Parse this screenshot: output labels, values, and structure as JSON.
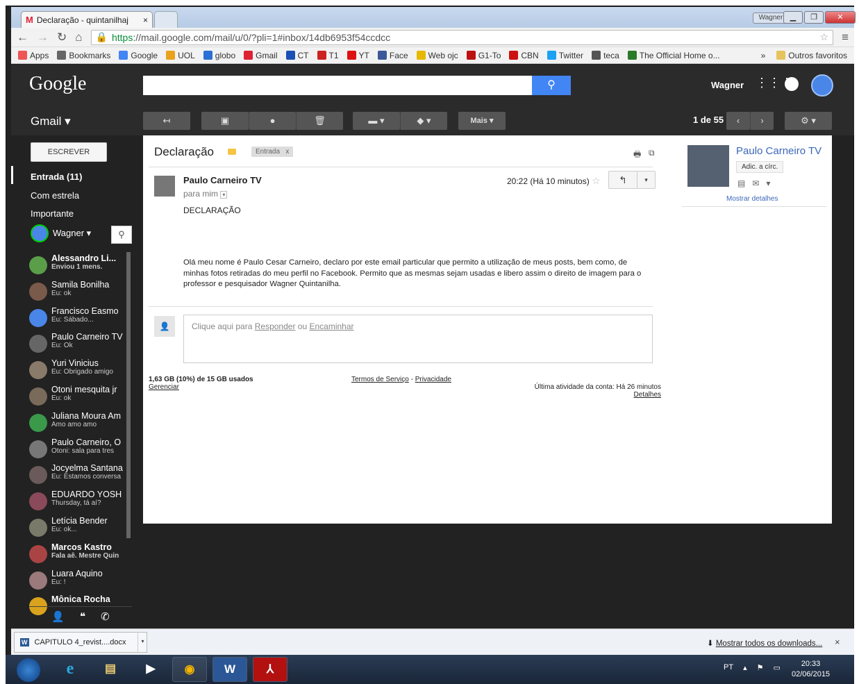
{
  "browser": {
    "tab_title": "Declaração - quintanilhaj",
    "tab_close": "×",
    "user_badge": "Wagner",
    "url_https": "https",
    "url_rest": "://mail.google.com/mail/u/0/?pli=1#inbox/14db6953f54ccdcc",
    "bookmarks": [
      {
        "label": "Apps",
        "icon": "apps-icon",
        "color": "#e55"
      },
      {
        "label": "Bookmarks",
        "icon": "star-icon",
        "color": "#666"
      },
      {
        "label": "Google",
        "icon": "google-icon",
        "color": "#4285f4"
      },
      {
        "label": "UOL",
        "icon": "uol-icon",
        "color": "#e9a21d"
      },
      {
        "label": "globo",
        "icon": "globo-icon",
        "color": "#2a6fd6"
      },
      {
        "label": "Gmail",
        "icon": "gmail-icon",
        "color": "#d23"
      },
      {
        "label": "CT",
        "icon": "ct-icon",
        "color": "#1a4fb6"
      },
      {
        "label": "T1",
        "icon": "t1-icon",
        "color": "#c22"
      },
      {
        "label": "YT",
        "icon": "youtube-icon",
        "color": "#d11"
      },
      {
        "label": "Face",
        "icon": "facebook-icon",
        "color": "#3b5998"
      },
      {
        "label": "Web ojc",
        "icon": "web-ojc-icon",
        "color": "#e6b800"
      },
      {
        "label": "G1-To",
        "icon": "g1-icon",
        "color": "#b11"
      },
      {
        "label": "CBN",
        "icon": "cbn-icon",
        "color": "#c11"
      },
      {
        "label": "Twitter",
        "icon": "twitter-icon",
        "color": "#1da1f2"
      },
      {
        "label": "teca",
        "icon": "teca-icon",
        "color": "#555"
      },
      {
        "label": "The Official Home o...",
        "icon": "official-home-icon",
        "color": "#2a7a2a"
      }
    ],
    "more": "»",
    "other_bookmarks": "Outros favoritos"
  },
  "gmail": {
    "logo": "Google",
    "user": "Wagner",
    "label": "Gmail ▾",
    "more_btn": "Mais ▾",
    "pager": "1 de 55",
    "compose": "ESCREVER",
    "nav": {
      "inbox": "Entrada (11)",
      "starred": "Com estrela",
      "important": "Importante"
    },
    "chat_user": "Wagner ▾",
    "contacts": [
      {
        "name": "Alessandro Li...",
        "status": "Enviou 1 mens.",
        "bold": true,
        "avatar": "#5a9e4a"
      },
      {
        "name": "Samila Bonilha",
        "status": "Eu: ok",
        "bold": false,
        "avatar": "#7a5a4a"
      },
      {
        "name": "Francisco Easmo",
        "status": "Eu: Sábado...",
        "bold": false,
        "avatar": "#4a86e8"
      },
      {
        "name": "Paulo Carneiro TV",
        "status": "Eu: Ok",
        "bold": false,
        "avatar": "#666"
      },
      {
        "name": "Yuri Vinicius",
        "status": "Eu: Obrigado amigo",
        "bold": false,
        "avatar": "#8a7a6a"
      },
      {
        "name": "Otoni mesquita jr",
        "status": "Eu: ok",
        "bold": false,
        "avatar": "#7a6a5a"
      },
      {
        "name": "Juliana Moura Am",
        "status": "Amo amo amo",
        "bold": false,
        "avatar": "#3a9a4a"
      },
      {
        "name": "Paulo Carneiro, O",
        "status": "Otoni: sala para tres",
        "bold": false,
        "avatar": "#777"
      },
      {
        "name": "Jocyelma Santana",
        "status": "Eu: Estamos conversa",
        "bold": false,
        "avatar": "#6a5a5a"
      },
      {
        "name": "EDUARDO YOSH",
        "status": "Thursday, tá aí?",
        "bold": false,
        "avatar": "#8a4a5a"
      },
      {
        "name": "Letícia Bender",
        "status": "Eu: ok...",
        "bold": false,
        "avatar": "#7a7a6a"
      },
      {
        "name": "Marcos Kastro",
        "status": "Fala aê. Mestre Quin",
        "bold": true,
        "avatar": "#a44"
      },
      {
        "name": "Luara Aquino",
        "status": "Eu: !",
        "bold": false,
        "avatar": "#9a7a7a"
      },
      {
        "name": "Mônica Rocha",
        "status": "",
        "bold": true,
        "avatar": "#d9a31d"
      }
    ]
  },
  "message": {
    "subject": "Declaração",
    "label_chip": "Entrada",
    "label_chip_x": "x",
    "sender": "Paulo Carneiro TV",
    "to": "para mim",
    "time": "20:22 (Há 10 minutos)",
    "title": "DECLARAÇÃO",
    "body": "Olá meu nome é Paulo Cesar Carneiro, declaro por este email particular que permito a utilização de meus posts, bem como, de minhas fotos retiradas do meu perfil no Facebook. Permito que as mesmas sejam usadas e libero assim o direito de imagem para o professor e pesquisador Wagner Quintanilha.",
    "reply_prefix": "Clique aqui para ",
    "reply_link": "Responder",
    "reply_or": " ou ",
    "forward_link": "Encaminhar"
  },
  "footer": {
    "storage": "1,63 GB (10%) de 15 GB usados",
    "manage": "Gerenciar",
    "terms": "Termos de Serviço",
    "dash": " - ",
    "privacy": "Privacidade",
    "activity": "Última atividade da conta: Há 26 minutos",
    "details": "Detalhes"
  },
  "contact_panel": {
    "name": "Paulo Carneiro TV",
    "add": "Adic. a círc.",
    "details": "Mostrar detalhes"
  },
  "downloads": {
    "file": "CAPITULO 4_revist....docx",
    "show_all": "Mostrar todos os downloads...",
    "close": "×"
  },
  "taskbar": {
    "lang": "PT",
    "time": "20:33",
    "date": "02/06/2015"
  }
}
